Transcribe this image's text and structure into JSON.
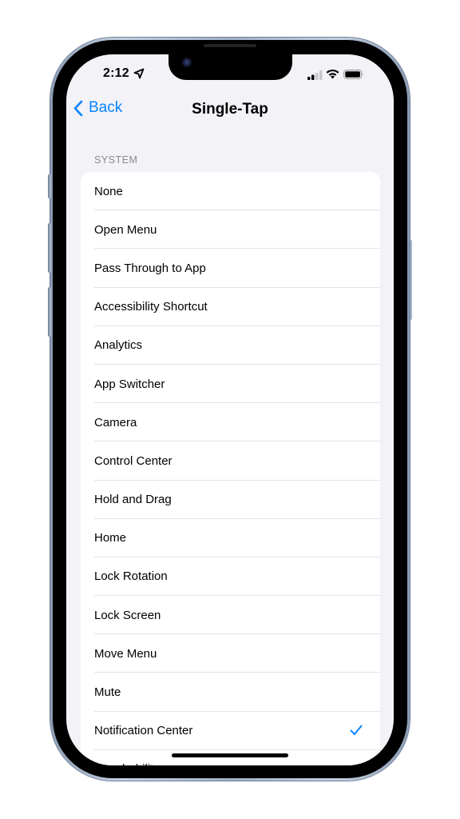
{
  "status_bar": {
    "time": "2:12",
    "location_icon": "location-arrow-icon",
    "signal_bars_filled": 2,
    "signal_bars_total": 4,
    "wifi_icon": "wifi-icon",
    "battery_icon": "battery-icon"
  },
  "nav": {
    "back_label": "Back",
    "back_icon": "chevron-left-icon",
    "title": "Single-Tap"
  },
  "section": {
    "header": "SYSTEM",
    "items": [
      {
        "label": "None",
        "selected": false
      },
      {
        "label": "Open Menu",
        "selected": false
      },
      {
        "label": "Pass Through to App",
        "selected": false
      },
      {
        "label": "Accessibility Shortcut",
        "selected": false
      },
      {
        "label": "Analytics",
        "selected": false
      },
      {
        "label": "App Switcher",
        "selected": false
      },
      {
        "label": "Camera",
        "selected": false
      },
      {
        "label": "Control Center",
        "selected": false
      },
      {
        "label": "Hold and Drag",
        "selected": false
      },
      {
        "label": "Home",
        "selected": false
      },
      {
        "label": "Lock Rotation",
        "selected": false
      },
      {
        "label": "Lock Screen",
        "selected": false
      },
      {
        "label": "Move Menu",
        "selected": false
      },
      {
        "label": "Mute",
        "selected": false
      },
      {
        "label": "Notification Center",
        "selected": true
      },
      {
        "label": "Reachability",
        "selected": false
      }
    ]
  },
  "colors": {
    "accent": "#0a84ff",
    "background": "#f2f2f7",
    "card": "#ffffff",
    "separator": "#e3e3e6",
    "section_header": "#8a8a8e"
  }
}
